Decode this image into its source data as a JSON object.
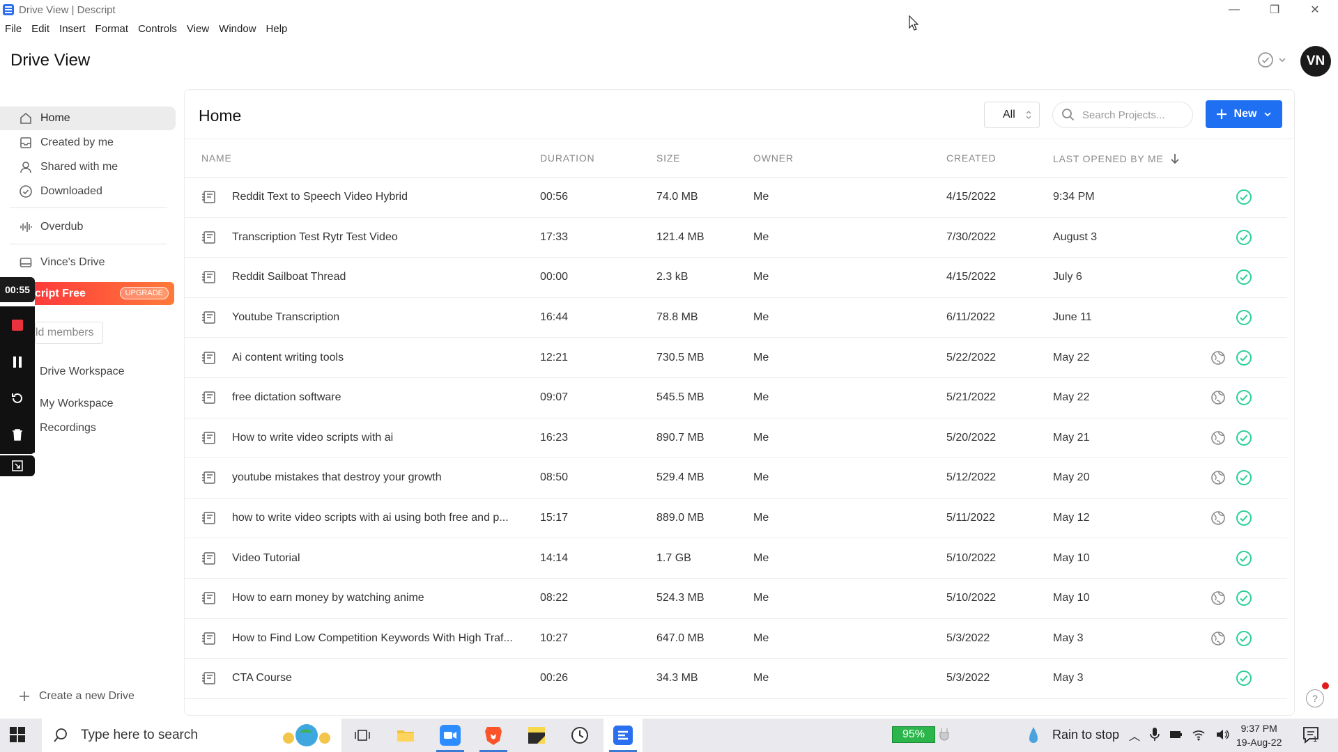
{
  "window": {
    "title": "Drive View | Descript",
    "minimize": "—",
    "maximize": "❐",
    "close": "✕"
  },
  "menu": [
    "File",
    "Edit",
    "Insert",
    "Format",
    "Controls",
    "View",
    "Window",
    "Help"
  ],
  "header": {
    "title": "Drive View",
    "avatar_initials": "VN"
  },
  "sidebar": {
    "items": [
      {
        "label": "Home",
        "icon": "home-icon"
      },
      {
        "label": "Created by me",
        "icon": "inbox-icon"
      },
      {
        "label": "Shared with me",
        "icon": "user-icon"
      },
      {
        "label": "Downloaded",
        "icon": "check-circle-icon"
      },
      {
        "label": "Overdub",
        "icon": "waveform-icon"
      },
      {
        "label": "Vince's Drive",
        "icon": "drive-icon"
      }
    ],
    "upgrade_text": "cript Free",
    "upgrade_badge": "UPGRADE",
    "members_text": "ld members",
    "workspaces": [
      "Drive Workspace",
      "My Workspace",
      "Recordings"
    ],
    "create_drive": "Create a new Drive"
  },
  "recorder": {
    "timer": "00:55"
  },
  "main": {
    "title": "Home",
    "filter_value": "All",
    "search_placeholder": "Search Projects...",
    "new_label": "New",
    "columns": {
      "name": "NAME",
      "duration": "DURATION",
      "size": "SIZE",
      "owner": "OWNER",
      "created": "CREATED",
      "last_opened": "LAST OPENED BY ME"
    },
    "rows": [
      {
        "name": "Reddit Text to Speech Video Hybrid",
        "duration": "00:56",
        "size": "74.0 MB",
        "owner": "Me",
        "created": "4/15/2022",
        "last": "9:34 PM",
        "shared": false
      },
      {
        "name": "Transcription Test Rytr Test Video",
        "duration": "17:33",
        "size": "121.4 MB",
        "owner": "Me",
        "created": "7/30/2022",
        "last": "August 3",
        "shared": false
      },
      {
        "name": "Reddit Sailboat Thread",
        "duration": "00:00",
        "size": "2.3 kB",
        "owner": "Me",
        "created": "4/15/2022",
        "last": "July 6",
        "shared": false
      },
      {
        "name": "Youtube Transcription",
        "duration": "16:44",
        "size": "78.8 MB",
        "owner": "Me",
        "created": "6/11/2022",
        "last": "June 11",
        "shared": false
      },
      {
        "name": "Ai content writing tools",
        "duration": "12:21",
        "size": "730.5 MB",
        "owner": "Me",
        "created": "5/22/2022",
        "last": "May 22",
        "shared": true
      },
      {
        "name": "free dictation software",
        "duration": "09:07",
        "size": "545.5 MB",
        "owner": "Me",
        "created": "5/21/2022",
        "last": "May 22",
        "shared": true
      },
      {
        "name": "How to write video scripts with ai",
        "duration": "16:23",
        "size": "890.7 MB",
        "owner": "Me",
        "created": "5/20/2022",
        "last": "May 21",
        "shared": true
      },
      {
        "name": "youtube mistakes that destroy your growth",
        "duration": "08:50",
        "size": "529.4 MB",
        "owner": "Me",
        "created": "5/12/2022",
        "last": "May 20",
        "shared": true
      },
      {
        "name": "how to write video scripts with ai using both free and p...",
        "duration": "15:17",
        "size": "889.0 MB",
        "owner": "Me",
        "created": "5/11/2022",
        "last": "May 12",
        "shared": true
      },
      {
        "name": "Video Tutorial",
        "duration": "14:14",
        "size": "1.7 GB",
        "owner": "Me",
        "created": "5/10/2022",
        "last": "May 10",
        "shared": false
      },
      {
        "name": "How to earn money by watching anime",
        "duration": "08:22",
        "size": "524.3 MB",
        "owner": "Me",
        "created": "5/10/2022",
        "last": "May 10",
        "shared": true
      },
      {
        "name": "How to Find Low Competition Keywords With High Traf...",
        "duration": "10:27",
        "size": "647.0 MB",
        "owner": "Me",
        "created": "5/3/2022",
        "last": "May 3",
        "shared": true
      },
      {
        "name": "CTA Course",
        "duration": "00:26",
        "size": "34.3 MB",
        "owner": "Me",
        "created": "5/3/2022",
        "last": "May 3",
        "shared": false
      }
    ]
  },
  "help_label": "?",
  "taskbar": {
    "search_placeholder": "Type here to search",
    "battery": "95%",
    "weather": "Rain to stop",
    "time": "9:37 PM",
    "date": "19-Aug-22",
    "notification_count": "1"
  },
  "colors": {
    "accent": "#1f6ff2",
    "check": "#2ccf9a",
    "upgrade_start": "#ff3b3b",
    "upgrade_end": "#ff7a3a"
  }
}
